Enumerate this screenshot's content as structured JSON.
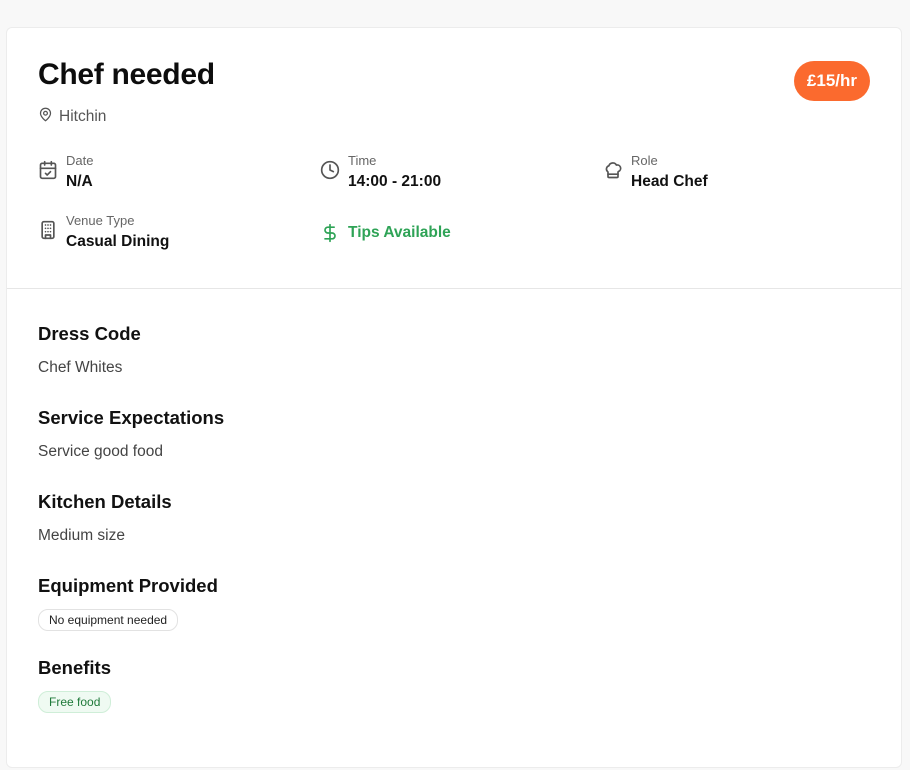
{
  "job": {
    "title": "Chef needed",
    "rate": "£15/hr",
    "location": "Hitchin"
  },
  "info": {
    "date": {
      "label": "Date",
      "value": "N/A"
    },
    "time": {
      "label": "Time",
      "value": "14:00 - 21:00"
    },
    "role": {
      "label": "Role",
      "value": "Head Chef"
    },
    "venue_type": {
      "label": "Venue Type",
      "value": "Casual Dining"
    },
    "tips": "Tips Available"
  },
  "sections": {
    "dress_code": {
      "heading": "Dress Code",
      "text": "Chef Whites"
    },
    "service_expectations": {
      "heading": "Service Expectations",
      "text": "Service good food"
    },
    "kitchen_details": {
      "heading": "Kitchen Details",
      "text": "Medium size"
    },
    "equipment": {
      "heading": "Equipment Provided",
      "chips": [
        "No equipment needed"
      ]
    },
    "benefits": {
      "heading": "Benefits",
      "chips": [
        "Free food"
      ]
    }
  },
  "colors": {
    "accent": "#fb6a2e",
    "tips_green": "#2ea356",
    "chip_green_bg": "#effaf2"
  },
  "icons": {
    "location": "map-pin-icon",
    "date": "calendar-check-icon",
    "time": "clock-icon",
    "role": "chef-hat-icon",
    "venue_type": "building-icon",
    "tips": "dollar-sign-icon"
  }
}
